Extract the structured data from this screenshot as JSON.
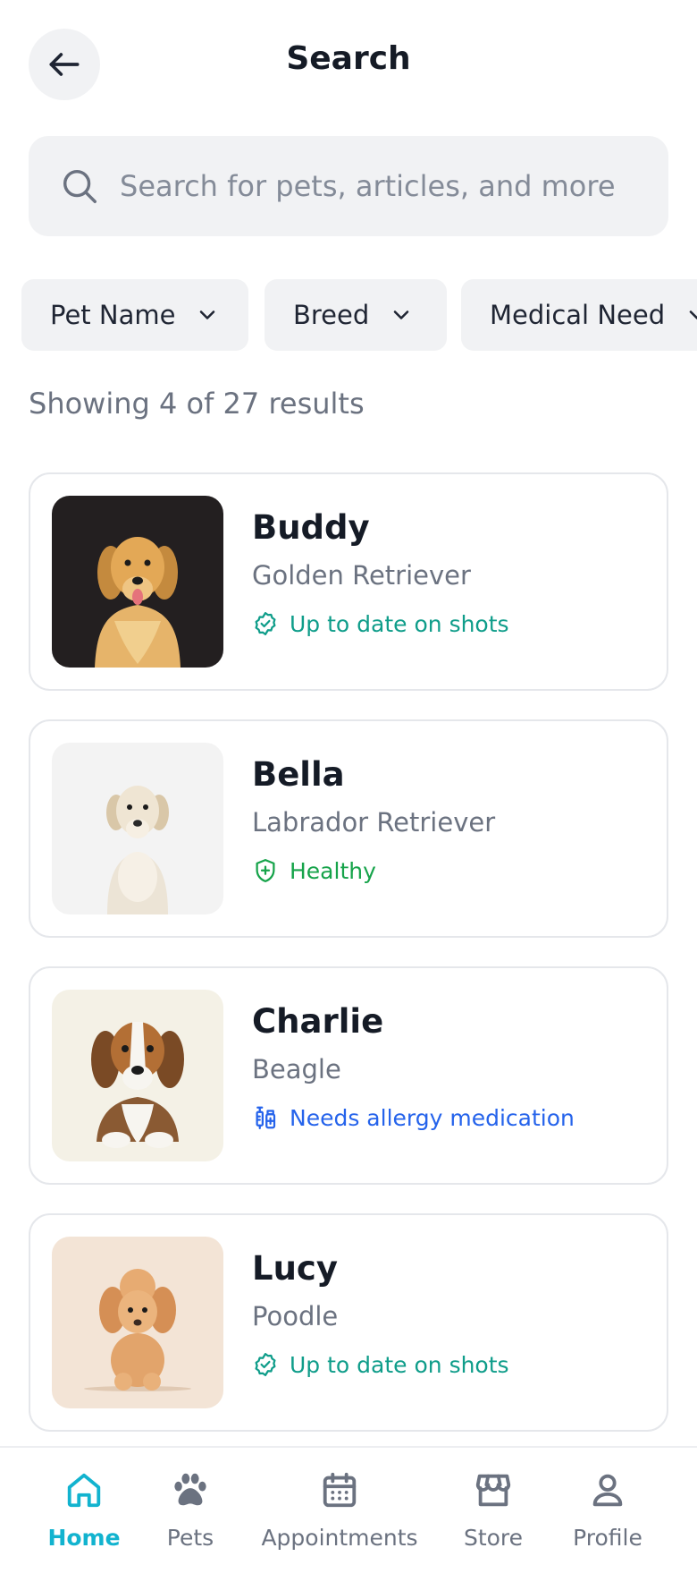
{
  "header": {
    "title": "Search",
    "back_icon": "arrow-left-icon"
  },
  "search": {
    "placeholder": "Search for pets, articles, and more",
    "value": "",
    "icon": "search-icon"
  },
  "filters": [
    {
      "label": "Pet Name",
      "icon": "chevron-down-icon"
    },
    {
      "label": "Breed",
      "icon": "chevron-down-icon"
    },
    {
      "label": "Medical Need",
      "icon": "chevron-down-icon"
    }
  ],
  "results": {
    "summary": "Showing 4 of 27 results",
    "items": [
      {
        "name": "Buddy",
        "breed": "Golden Retriever",
        "status": "Up to date on shots",
        "status_icon": "badge-check-icon",
        "status_color": "#0f9d8a"
      },
      {
        "name": "Bella",
        "breed": "Labrador Retriever",
        "status": "Healthy",
        "status_icon": "shield-plus-icon",
        "status_color": "#16a34a"
      },
      {
        "name": "Charlie",
        "breed": "Beagle",
        "status": "Needs allergy medication",
        "status_icon": "syringe-icon",
        "status_color": "#2563eb"
      },
      {
        "name": "Lucy",
        "breed": "Poodle",
        "status": "Up to date on shots",
        "status_icon": "badge-check-icon",
        "status_color": "#0f9d8a"
      }
    ]
  },
  "nav": {
    "active_color": "#12b3cf",
    "items": [
      {
        "label": "Home",
        "icon": "home-icon",
        "active": true
      },
      {
        "label": "Pets",
        "icon": "paw-icon",
        "active": false
      },
      {
        "label": "Appointments",
        "icon": "calendar-icon",
        "active": false
      },
      {
        "label": "Store",
        "icon": "store-icon",
        "active": false
      },
      {
        "label": "Profile",
        "icon": "user-icon",
        "active": false
      }
    ]
  }
}
